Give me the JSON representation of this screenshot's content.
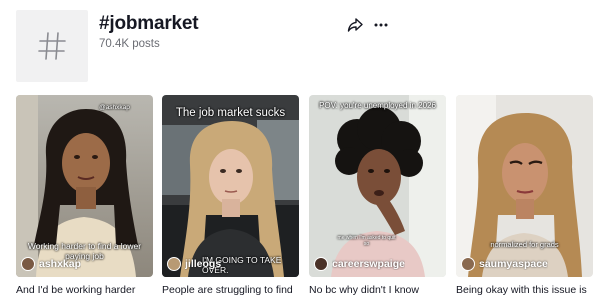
{
  "header": {
    "tag_title": "#jobmarket",
    "posts_count": "70.4K posts",
    "icons": {
      "thumb": "hashtag-icon",
      "share": "share-arrow-icon",
      "more": "ellipsis-icon"
    }
  },
  "videos": [
    {
      "top_text": "@ashxkap",
      "mid_text": "Working harder to find a lower paying job",
      "author": "ashxkap",
      "caption": "And I'd be working harder"
    },
    {
      "top_text": "The job market sucks",
      "mid_text": "I'M GOING TO TAKE OVER.",
      "author": "jilleogs",
      "caption": "People are struggling to find"
    },
    {
      "top_text": "POV: you're unemployed in 2026",
      "mid_text": "me when I'm asked to quit so",
      "author": "careerswpaige",
      "caption": "No bc why didn't I know"
    },
    {
      "top_text": "",
      "mid_text": "normalized for grads",
      "author": "saumyaspace",
      "caption": "Being okay with this issue is"
    }
  ],
  "colors": {
    "text_primary": "#161823",
    "text_secondary": "#6b6d74",
    "thumb_bg": "#f1f1f2"
  }
}
